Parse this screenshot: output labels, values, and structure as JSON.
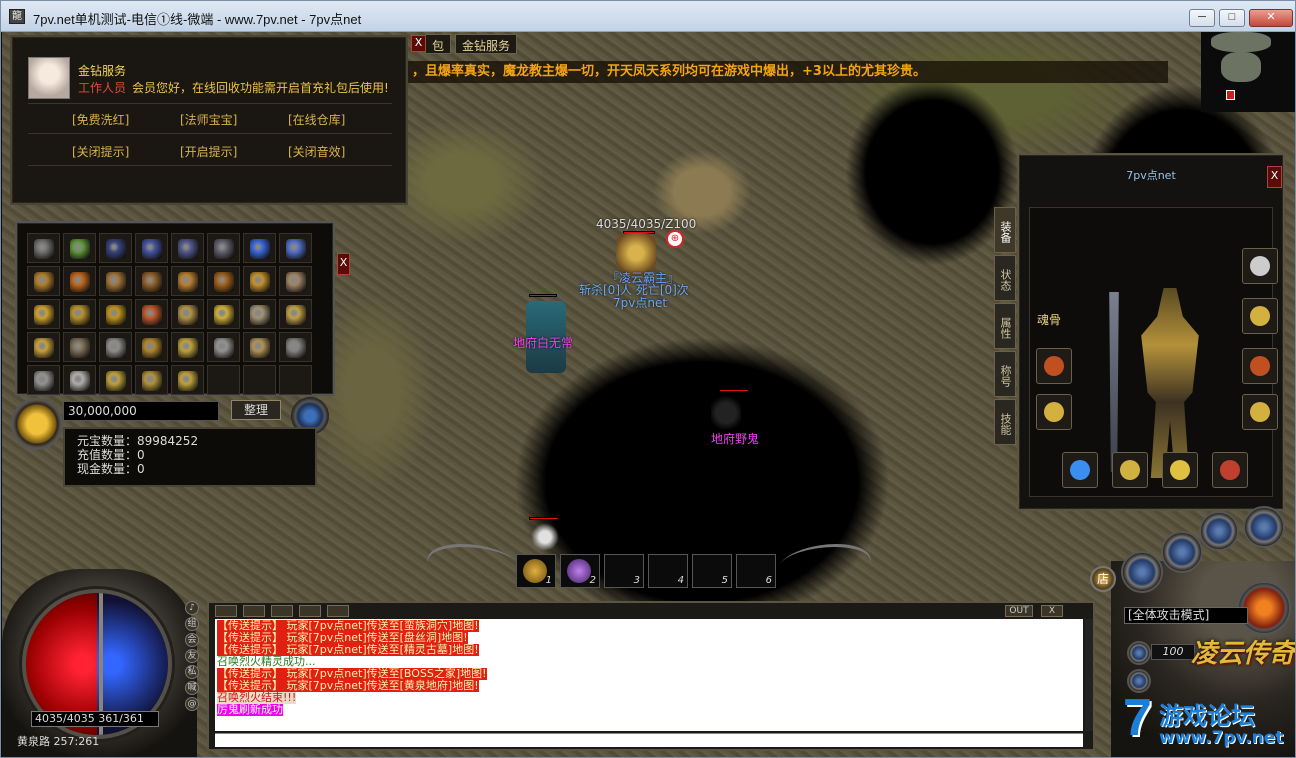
{
  "window": {
    "title": "7pv.net单机测试-电信①线-微端 - www.7pv.net - 7pv点net",
    "icon": "game-icon",
    "buttons": {
      "minimize": "─",
      "maximize": "□",
      "close": "✕"
    }
  },
  "npc_dialog": {
    "title": "金钻服务",
    "role": "工作人员",
    "message": "会员您好，在线回收功能需开启首充礼包后使用!",
    "links": [
      "[免费洗红]",
      "[法师宝宝]",
      "[在线仓库]",
      "[关闭提示]",
      "[开启提示]",
      "[关闭音效]"
    ],
    "close": "X"
  },
  "top_buttons": [
    "包",
    "金钻服务"
  ],
  "marquee": "，且爆率真实，魔龙教主爆一切，开天凤天系列均可在游戏中爆出，+3以上的尤其珍贵。",
  "minimap": {
    "marker_color": "#d21d1d"
  },
  "inventory": {
    "close": "X",
    "gold": "30,000,000",
    "sort_button": "整理",
    "items": [
      {
        "color": "#7c7c7c"
      },
      {
        "color": "#6aa844"
      },
      {
        "color": "#3a4a8a"
      },
      {
        "color": "#4a5ab0"
      },
      {
        "color": "#58609a"
      },
      {
        "color": "#6a6a7a"
      },
      {
        "color": "#3c70f0"
      },
      {
        "color": "#5a7ae0"
      },
      {
        "color": "#c08a30"
      },
      {
        "color": "#d07020"
      },
      {
        "color": "#b08040"
      },
      {
        "color": "#a06a30"
      },
      {
        "color": "#c98a35"
      },
      {
        "color": "#b06a20"
      },
      {
        "color": "#d4a030"
      },
      {
        "color": "#b09070"
      },
      {
        "color": "#e0b030"
      },
      {
        "color": "#c8a030"
      },
      {
        "color": "#d0a020"
      },
      {
        "color": "#d06030"
      },
      {
        "color": "#c0a050"
      },
      {
        "color": "#e0c040"
      },
      {
        "color": "#b0a080"
      },
      {
        "color": "#d0b050"
      },
      {
        "color": "#d8b040"
      },
      {
        "color": "#8a7a60"
      },
      {
        "color": "#9a9a9a"
      },
      {
        "color": "#c09030"
      },
      {
        "color": "#d0b040"
      },
      {
        "color": "#a0a0a0"
      },
      {
        "color": "#c0a060"
      },
      {
        "color": "#909090"
      },
      {
        "color": "#a0a0a0"
      },
      {
        "color": "#bfbfbf"
      },
      {
        "color": "#d0b040"
      },
      {
        "color": "#c0a040"
      },
      {
        "color": "#d0b040"
      },
      {
        "color": ""
      },
      {
        "color": ""
      },
      {
        "color": ""
      }
    ]
  },
  "currency": {
    "yuanbao": "元宝数量：89984252",
    "chongzhi": "充值数量：0",
    "xianjin": "现金数量：0"
  },
  "world": {
    "player_hp": "4035/4035/Z100",
    "player_title": "『凌云霸主』",
    "player_stats": "斩杀[0]人  死亡[0]次",
    "player_name": "7pv点net",
    "mob1": "地府白无常",
    "mob2": "地府野鬼",
    "name_colors": {
      "player": "#68a8f0",
      "title": "#6aa0ff",
      "mob": "#f040f0",
      "hp": "#ffffff"
    }
  },
  "equipment": {
    "title": "7pv点net",
    "close": "X",
    "tabs": [
      "装备",
      "状态",
      "属性",
      "称号",
      "技能"
    ],
    "hun_label": "魂骨"
  },
  "hud": {
    "hp_mp": "4035/4035  361/361",
    "location": "黄泉路  257:261",
    "mode": "[全体攻击模式]",
    "level": "100",
    "shop": "店",
    "logo": "凌云传奇",
    "skill_keys": [
      "1",
      "2",
      "3",
      "4",
      "5",
      "6"
    ]
  },
  "chat": {
    "ctl_out": "OUT",
    "ctl_x": "X",
    "lines": [
      {
        "type": "red",
        "text": "【传送提示】 玩家[7pv点net]传送至[蛮族洞穴]地图!"
      },
      {
        "type": "red",
        "text": "【传送提示】 玩家[7pv点net]传送至[盘丝洞]地图!"
      },
      {
        "type": "red",
        "text": "【传送提示】 玩家[7pv点net]传送至[精灵古墓]地图!"
      },
      {
        "type": "green",
        "text": "召唤烈火精灵成功..."
      },
      {
        "type": "red",
        "text": "【传送提示】 玩家[7pv点net]传送至[BOSS之家]地图!"
      },
      {
        "type": "red",
        "text": "【传送提示】 玩家[7pv点net]传送至[黄泉地府]地图!"
      },
      {
        "type": "kred",
        "text": "召唤烈火结束!!!"
      },
      {
        "type": "mag",
        "text": "厉鬼刷新成功"
      }
    ]
  },
  "watermark": {
    "seven": "7",
    "line1": "游戏论坛",
    "line2": "www.7pv.net"
  }
}
